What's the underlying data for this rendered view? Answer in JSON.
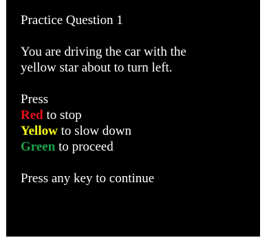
{
  "screen": {
    "title": "Practice Question 1",
    "instruction_lines": [
      "You are driving the car with the",
      "yellow star about to turn left."
    ],
    "press_label": "Press",
    "options": [
      {
        "color_word": "Red",
        "color": "#e8101a",
        "rest": " to stop"
      },
      {
        "color_word": "Yellow",
        "color": "#ffff1a",
        "rest": " to slow down"
      },
      {
        "color_word": "Green",
        "color": "#1aa54a",
        "rest": " to proceed"
      }
    ],
    "continue_text": "Press any key to continue"
  },
  "colors": {
    "background": "#000000",
    "text": "#ffffff"
  }
}
